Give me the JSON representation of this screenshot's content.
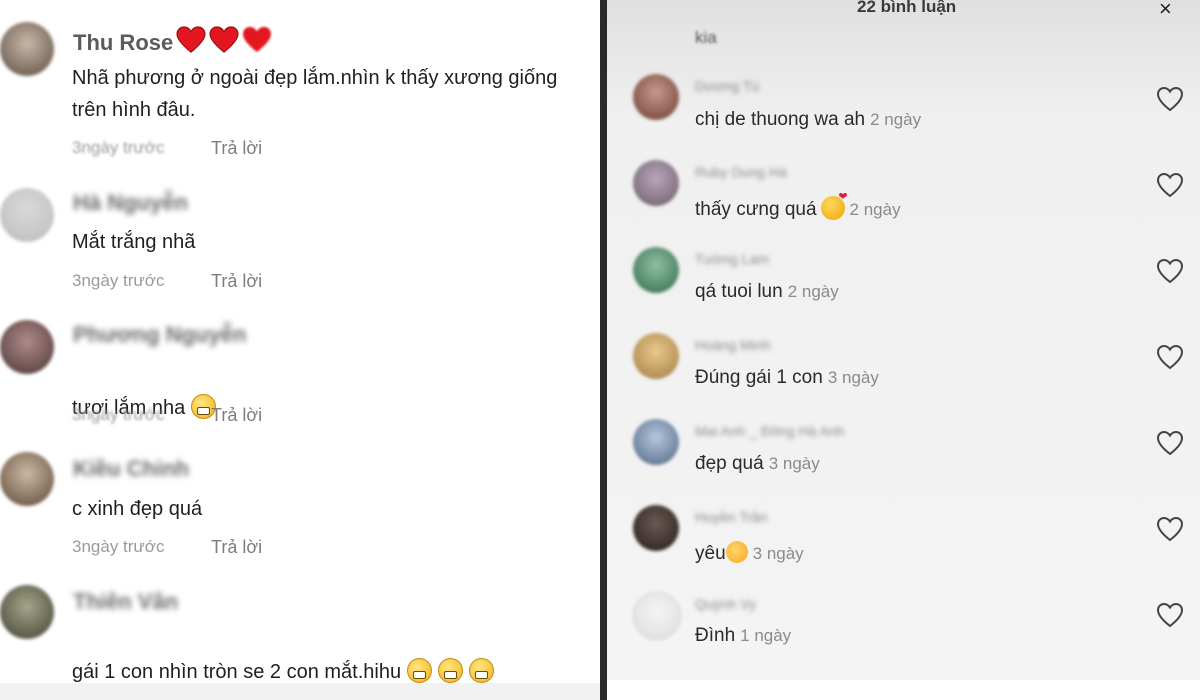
{
  "left_panel": {
    "comments": [
      {
        "username": "Thu Rose",
        "text": "Nhã phương ở ngoài đẹp lắm.nhìn k thấy xương giống\ntrên hình đâu.",
        "time": "3ngày trước",
        "reply": "Trả lời",
        "hearts": 3
      },
      {
        "username": "Hà Nguyễn",
        "text": "Mắt trắng nhã",
        "time": "3ngày trước",
        "reply": "Trả lời"
      },
      {
        "username": "Phương Nguyễn",
        "text": "tươi lắm nha",
        "time": "3ngày trước",
        "reply": "Trả lời",
        "emoji": "grin-emoji"
      },
      {
        "username": "Kiều Chinh",
        "text": "c xinh đẹp quá",
        "time": "3ngày trước",
        "reply": "Trả lời"
      },
      {
        "username": "Thiên Vân",
        "text": "gái 1 con nhìn tròn se 2 con mắt.hihu",
        "emoji": "laugh-emoji"
      }
    ]
  },
  "right_panel": {
    "title": "22 bình luận",
    "close_icon": "×",
    "previous_snippet": "kia",
    "comments": [
      {
        "username": "Dương Tú",
        "text": "chị de thuong wa ah",
        "time": "2 ngày"
      },
      {
        "username": "Ruby Dung Hà",
        "text": "thấy cưng quá",
        "time": "2 ngày",
        "emoji": "kiss-emoji"
      },
      {
        "username": "Tường Lam",
        "text": "qá tuoi lun",
        "time": "2 ngày"
      },
      {
        "username": "Hoàng Minh",
        "text": "Đúng gái 1 con",
        "time": "3 ngày"
      },
      {
        "username": "Mai Anh _ Đông Hà Anh",
        "text": "đẹp quá",
        "time": "3 ngày"
      },
      {
        "username": "Huyền Trần",
        "text": "yêu",
        "time": "3 ngày",
        "emoji": "shy-emoji"
      },
      {
        "username": "Quỳnh Vy",
        "text": "Đình",
        "time": "1 ngày"
      }
    ]
  }
}
